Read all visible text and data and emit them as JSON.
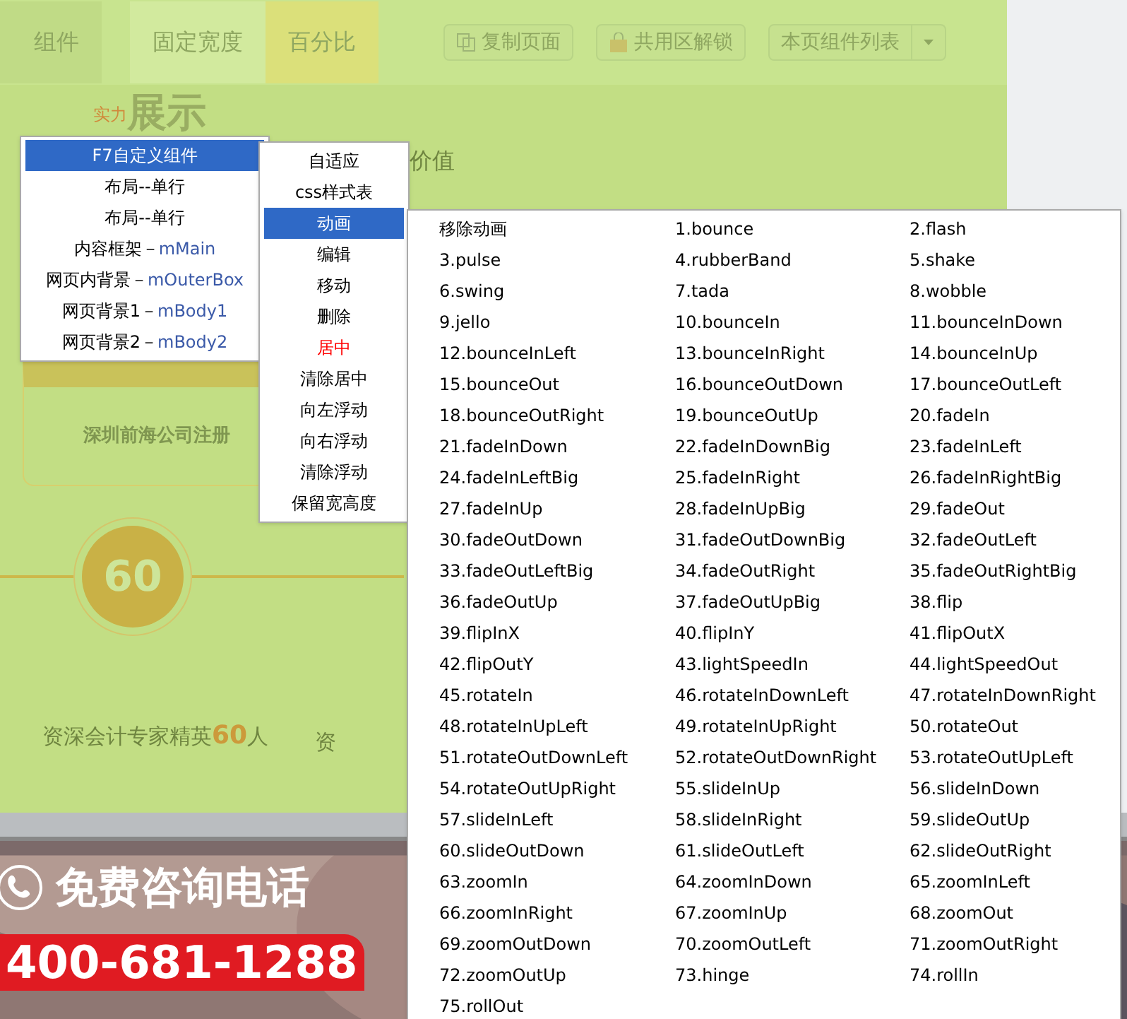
{
  "toolbar": {
    "tabs": [
      {
        "label": "组件",
        "selected": false
      },
      {
        "label": "固定宽度",
        "selected": false
      },
      {
        "label": "百分比",
        "selected": true
      }
    ],
    "buttons": [
      {
        "label": "复制页面"
      },
      {
        "label": "共用区解锁"
      }
    ],
    "dropdown": {
      "label": "本页组件列表"
    }
  },
  "page": {
    "heading_small": "实力",
    "heading": "展示",
    "subtitle": "价值",
    "card": "深圳前海公司注册",
    "counter": "60",
    "counter_caption": "资深会计专家精英**60**人",
    "caption_cut": "资",
    "contact_title": "免费咨询电话",
    "phone": "400-681-1288"
  },
  "menu": {
    "items": [
      {
        "label": "F7自定义组件",
        "selected": true
      },
      {
        "label": "布局--单行",
        "selected": false
      },
      {
        "label": "布局--单行",
        "selected": false
      },
      {
        "label": "内容框架－ ",
        "code": "mMain",
        "selected": false
      },
      {
        "label": "网页内背景－ ",
        "code": "mOuterBox",
        "selected": false
      },
      {
        "label": "网页背景1－ ",
        "code": "mBody1",
        "selected": false
      },
      {
        "label": "网页背景2－ ",
        "code": "mBody2",
        "selected": false
      }
    ]
  },
  "submenu": {
    "items": [
      {
        "label": "自适应",
        "selected": false,
        "warning": false
      },
      {
        "label": "css样式表",
        "selected": false,
        "warning": false
      },
      {
        "label": "动画",
        "selected": true,
        "warning": false
      },
      {
        "label": "编辑",
        "selected": false,
        "warning": false
      },
      {
        "label": "移动",
        "selected": false,
        "warning": false
      },
      {
        "label": "删除",
        "selected": false,
        "warning": false
      },
      {
        "label": "居中",
        "selected": false,
        "warning": true
      },
      {
        "label": "清除居中",
        "selected": false,
        "warning": false
      },
      {
        "label": "向左浮动",
        "selected": false,
        "warning": false
      },
      {
        "label": "向右浮动",
        "selected": false,
        "warning": false
      },
      {
        "label": "清除浮动",
        "selected": false,
        "warning": false
      },
      {
        "label": "保留宽高度",
        "selected": false,
        "warning": false
      }
    ]
  },
  "animations": [
    "移除动画",
    "1.bounce",
    "2.flash",
    "3.pulse",
    "4.rubberBand",
    "5.shake",
    "6.swing",
    "7.tada",
    "8.wobble",
    "9.jello",
    "10.bounceIn",
    "11.bounceInDown",
    "12.bounceInLeft",
    "13.bounceInRight",
    "14.bounceInUp",
    "15.bounceOut",
    "16.bounceOutDown",
    "17.bounceOutLeft",
    "18.bounceOutRight",
    "19.bounceOutUp",
    "20.fadeIn",
    "21.fadeInDown",
    "22.fadeInDownBig",
    "23.fadeInLeft",
    "24.fadeInLeftBig",
    "25.fadeInRight",
    "26.fadeInRightBig",
    "27.fadeInUp",
    "28.fadeInUpBig",
    "29.fadeOut",
    "30.fadeOutDown",
    "31.fadeOutDownBig",
    "32.fadeOutLeft",
    "33.fadeOutLeftBig",
    "34.fadeOutRight",
    "35.fadeOutRightBig",
    "36.fadeOutUp",
    "37.fadeOutUpBig",
    "38.flip",
    "39.flipInX",
    "40.flipInY",
    "41.flipOutX",
    "42.flipOutY",
    "43.lightSpeedIn",
    "44.lightSpeedOut",
    "45.rotateIn",
    "46.rotateInDownLeft",
    "47.rotateInDownRight",
    "48.rotateInUpLeft",
    "49.rotateInUpRight",
    "50.rotateOut",
    "51.rotateOutDownLeft",
    "52.rotateOutDownRight",
    "53.rotateOutUpLeft",
    "54.rotateOutUpRight",
    "55.slideInUp",
    "56.slideInDown",
    "57.slideInLeft",
    "58.slideInRight",
    "59.slideOutUp",
    "60.slideOutDown",
    "61.slideOutLeft",
    "62.slideOutRight",
    "63.zoomIn",
    "64.zoomInDown",
    "65.zoomInLeft",
    "66.zoomInRight",
    "67.zoomInUp",
    "68.zoomOut",
    "69.zoomOutDown",
    "70.zoomOutLeft",
    "71.zoomOutRight",
    "72.zoomOutUp",
    "73.hinge",
    "74.rollIn",
    "75.rollOut"
  ]
}
